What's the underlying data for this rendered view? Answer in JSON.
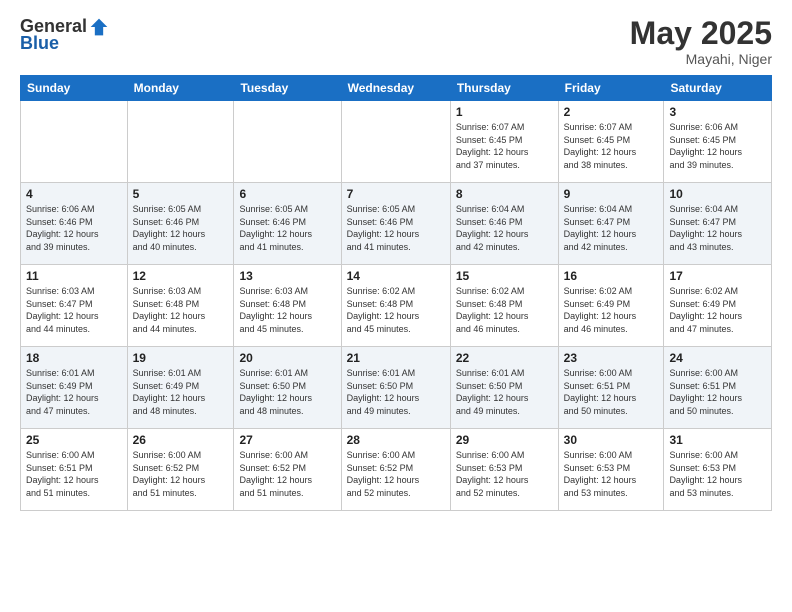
{
  "header": {
    "logo_general": "General",
    "logo_blue": "Blue",
    "month": "May 2025",
    "location": "Mayahi, Niger"
  },
  "weekdays": [
    "Sunday",
    "Monday",
    "Tuesday",
    "Wednesday",
    "Thursday",
    "Friday",
    "Saturday"
  ],
  "weeks": [
    [
      {
        "day": "",
        "info": ""
      },
      {
        "day": "",
        "info": ""
      },
      {
        "day": "",
        "info": ""
      },
      {
        "day": "",
        "info": ""
      },
      {
        "day": "1",
        "info": "Sunrise: 6:07 AM\nSunset: 6:45 PM\nDaylight: 12 hours\nand 37 minutes."
      },
      {
        "day": "2",
        "info": "Sunrise: 6:07 AM\nSunset: 6:45 PM\nDaylight: 12 hours\nand 38 minutes."
      },
      {
        "day": "3",
        "info": "Sunrise: 6:06 AM\nSunset: 6:45 PM\nDaylight: 12 hours\nand 39 minutes."
      }
    ],
    [
      {
        "day": "4",
        "info": "Sunrise: 6:06 AM\nSunset: 6:46 PM\nDaylight: 12 hours\nand 39 minutes."
      },
      {
        "day": "5",
        "info": "Sunrise: 6:05 AM\nSunset: 6:46 PM\nDaylight: 12 hours\nand 40 minutes."
      },
      {
        "day": "6",
        "info": "Sunrise: 6:05 AM\nSunset: 6:46 PM\nDaylight: 12 hours\nand 41 minutes."
      },
      {
        "day": "7",
        "info": "Sunrise: 6:05 AM\nSunset: 6:46 PM\nDaylight: 12 hours\nand 41 minutes."
      },
      {
        "day": "8",
        "info": "Sunrise: 6:04 AM\nSunset: 6:46 PM\nDaylight: 12 hours\nand 42 minutes."
      },
      {
        "day": "9",
        "info": "Sunrise: 6:04 AM\nSunset: 6:47 PM\nDaylight: 12 hours\nand 42 minutes."
      },
      {
        "day": "10",
        "info": "Sunrise: 6:04 AM\nSunset: 6:47 PM\nDaylight: 12 hours\nand 43 minutes."
      }
    ],
    [
      {
        "day": "11",
        "info": "Sunrise: 6:03 AM\nSunset: 6:47 PM\nDaylight: 12 hours\nand 44 minutes."
      },
      {
        "day": "12",
        "info": "Sunrise: 6:03 AM\nSunset: 6:48 PM\nDaylight: 12 hours\nand 44 minutes."
      },
      {
        "day": "13",
        "info": "Sunrise: 6:03 AM\nSunset: 6:48 PM\nDaylight: 12 hours\nand 45 minutes."
      },
      {
        "day": "14",
        "info": "Sunrise: 6:02 AM\nSunset: 6:48 PM\nDaylight: 12 hours\nand 45 minutes."
      },
      {
        "day": "15",
        "info": "Sunrise: 6:02 AM\nSunset: 6:48 PM\nDaylight: 12 hours\nand 46 minutes."
      },
      {
        "day": "16",
        "info": "Sunrise: 6:02 AM\nSunset: 6:49 PM\nDaylight: 12 hours\nand 46 minutes."
      },
      {
        "day": "17",
        "info": "Sunrise: 6:02 AM\nSunset: 6:49 PM\nDaylight: 12 hours\nand 47 minutes."
      }
    ],
    [
      {
        "day": "18",
        "info": "Sunrise: 6:01 AM\nSunset: 6:49 PM\nDaylight: 12 hours\nand 47 minutes."
      },
      {
        "day": "19",
        "info": "Sunrise: 6:01 AM\nSunset: 6:49 PM\nDaylight: 12 hours\nand 48 minutes."
      },
      {
        "day": "20",
        "info": "Sunrise: 6:01 AM\nSunset: 6:50 PM\nDaylight: 12 hours\nand 48 minutes."
      },
      {
        "day": "21",
        "info": "Sunrise: 6:01 AM\nSunset: 6:50 PM\nDaylight: 12 hours\nand 49 minutes."
      },
      {
        "day": "22",
        "info": "Sunrise: 6:01 AM\nSunset: 6:50 PM\nDaylight: 12 hours\nand 49 minutes."
      },
      {
        "day": "23",
        "info": "Sunrise: 6:00 AM\nSunset: 6:51 PM\nDaylight: 12 hours\nand 50 minutes."
      },
      {
        "day": "24",
        "info": "Sunrise: 6:00 AM\nSunset: 6:51 PM\nDaylight: 12 hours\nand 50 minutes."
      }
    ],
    [
      {
        "day": "25",
        "info": "Sunrise: 6:00 AM\nSunset: 6:51 PM\nDaylight: 12 hours\nand 51 minutes."
      },
      {
        "day": "26",
        "info": "Sunrise: 6:00 AM\nSunset: 6:52 PM\nDaylight: 12 hours\nand 51 minutes."
      },
      {
        "day": "27",
        "info": "Sunrise: 6:00 AM\nSunset: 6:52 PM\nDaylight: 12 hours\nand 51 minutes."
      },
      {
        "day": "28",
        "info": "Sunrise: 6:00 AM\nSunset: 6:52 PM\nDaylight: 12 hours\nand 52 minutes."
      },
      {
        "day": "29",
        "info": "Sunrise: 6:00 AM\nSunset: 6:53 PM\nDaylight: 12 hours\nand 52 minutes."
      },
      {
        "day": "30",
        "info": "Sunrise: 6:00 AM\nSunset: 6:53 PM\nDaylight: 12 hours\nand 53 minutes."
      },
      {
        "day": "31",
        "info": "Sunrise: 6:00 AM\nSunset: 6:53 PM\nDaylight: 12 hours\nand 53 minutes."
      }
    ]
  ]
}
